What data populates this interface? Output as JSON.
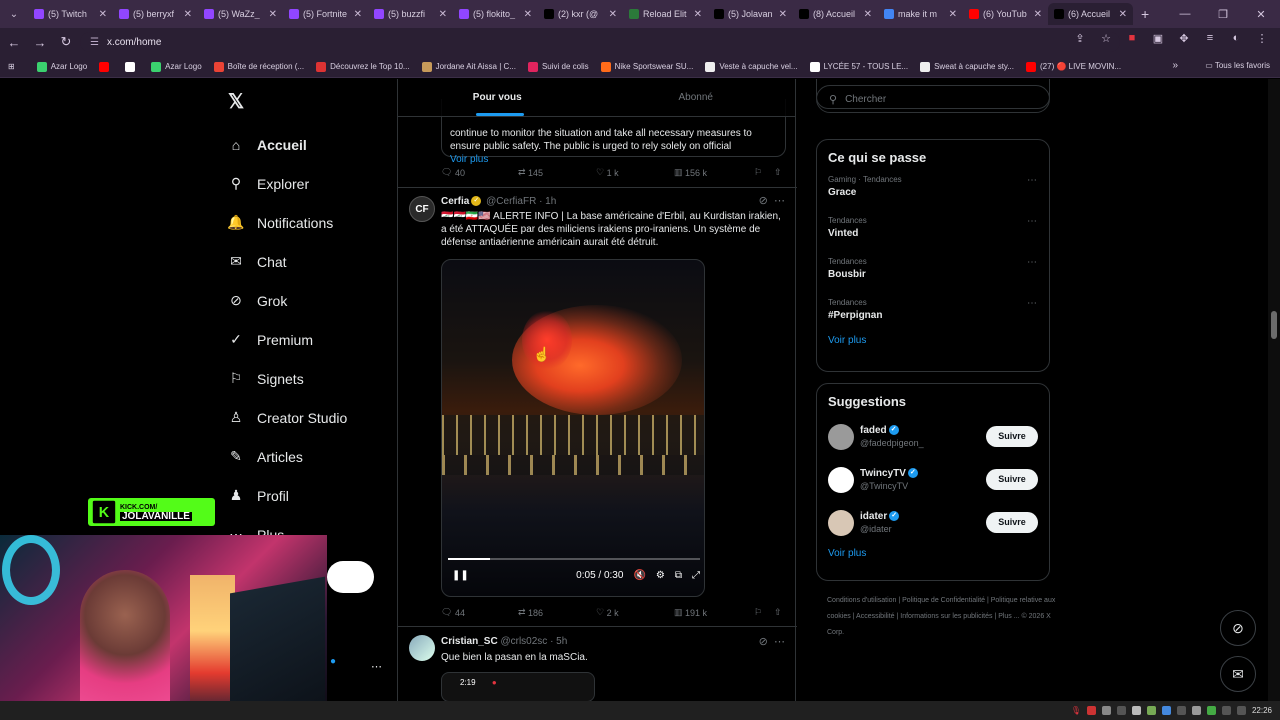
{
  "browser": {
    "tabs": [
      {
        "title": "(5) Twitch",
        "color": "#9146ff"
      },
      {
        "title": "(5) berryxf",
        "color": "#9146ff"
      },
      {
        "title": "(5) WaZz_",
        "color": "#9146ff"
      },
      {
        "title": "(5) Fortnite",
        "color": "#9146ff"
      },
      {
        "title": "(5) buzzfi",
        "color": "#9146ff"
      },
      {
        "title": "(5) flokito_",
        "color": "#9146ff"
      },
      {
        "title": "(2) kxr (@",
        "color": "#000000"
      },
      {
        "title": "Reload Elit",
        "color": "#2b7a3a"
      },
      {
        "title": "(5) Jolavan",
        "color": "#000000"
      },
      {
        "title": "(8) Accueil",
        "color": "#000000"
      },
      {
        "title": "make it m",
        "color": "#4285f4"
      },
      {
        "title": "(6) YouTub",
        "color": "#ff0000"
      },
      {
        "title": "(6) Accueil",
        "color": "#000000",
        "active": true
      }
    ],
    "url": "x.com/home",
    "bookmarks": [
      {
        "label": "Azar Logo",
        "color": "#3bd16f"
      },
      {
        "label": "",
        "color": "#ff0000"
      },
      {
        "label": "",
        "color": "#ffffff"
      },
      {
        "label": "Azar Logo",
        "color": "#3bd16f"
      },
      {
        "label": "Boîte de réception (...",
        "color": "#ea4335"
      },
      {
        "label": "Découvrez le Top 10...",
        "color": "#d33"
      },
      {
        "label": "Jordane Ait Aissa | C...",
        "color": "#c79a5a"
      },
      {
        "label": "Suivi de colis",
        "color": "#e0245e"
      },
      {
        "label": "Nike Sportswear SU...",
        "color": "#ff6b1a"
      },
      {
        "label": "Veste à capuche vel...",
        "color": "#eeeeee"
      },
      {
        "label": "LYCÉE 57 - TOUS LE...",
        "color": "#ffffff"
      },
      {
        "label": "Sweat à capuche sty...",
        "color": "#eeeeee"
      },
      {
        "label": "(27) 🔴 LIVE MOVIN...",
        "color": "#ff0000"
      }
    ],
    "all_bookmarks": "Tous les favoris"
  },
  "sidebar": {
    "items": [
      {
        "label": "Accueil",
        "icon": "home-icon",
        "glyph": "⌂",
        "active": true
      },
      {
        "label": "Explorer",
        "icon": "search-icon",
        "glyph": "⚲"
      },
      {
        "label": "Notifications",
        "icon": "bell-icon",
        "glyph": "🔔"
      },
      {
        "label": "Chat",
        "icon": "mail-icon",
        "glyph": "✉"
      },
      {
        "label": "Grok",
        "icon": "grok-icon",
        "glyph": "⊘"
      },
      {
        "label": "Premium",
        "icon": "verified-icon",
        "glyph": "✓"
      },
      {
        "label": "Signets",
        "icon": "bookmark-icon",
        "glyph": "⚐"
      },
      {
        "label": "Creator Studio",
        "icon": "creator-icon",
        "glyph": "♙"
      },
      {
        "label": "Articles",
        "icon": "article-icon",
        "glyph": "✎"
      },
      {
        "label": "Profil",
        "icon": "profile-icon",
        "glyph": "♟"
      },
      {
        "label": "Plus",
        "icon": "more-icon",
        "glyph": "⋯"
      }
    ]
  },
  "feed": {
    "tabs": [
      {
        "label": "Pour vous",
        "active": true
      },
      {
        "label": "Abonné"
      }
    ],
    "quoted_tail": {
      "text": "continue to monitor the situation and take all necessary measures to ensure public safety. The public is urged to rely solely on official",
      "more": "Voir plus",
      "stats": {
        "replies": "40",
        "reposts": "145",
        "likes": "1 k",
        "views": "156 k"
      }
    },
    "post1": {
      "name": "Cerfia",
      "handle": "@CerfiaFR · 1h",
      "text": "🇮🇶🇮🇶🇮🇷🇺🇸 ALERTE INFO | La base américaine d'Erbil, au Kurdistan irakien, a été ATTAQUÉE par des miliciens irakiens pro-iraniens. Un système de défense antiaérienne américain aurait été détruit.",
      "video_time": "0:05 / 0:30",
      "video_progress": 0.1667,
      "stats": {
        "replies": "44",
        "reposts": "186",
        "likes": "2 k",
        "views": "191 k"
      }
    },
    "post2": {
      "name": "Cristian_SC",
      "handle": "@crls02sc · 5h",
      "text": "Que bien la pasan en la maSCia.",
      "phone_time": "2:19"
    }
  },
  "right": {
    "search_placeholder": "Chercher",
    "trends_title": "Ce qui se passe",
    "trends": [
      {
        "category": "Gaming · Tendances",
        "name": "Grace"
      },
      {
        "category": "Tendances",
        "name": "Vinted"
      },
      {
        "category": "Tendances",
        "name": "Bousbir"
      },
      {
        "category": "Tendances",
        "name": "#Perpignan"
      }
    ],
    "trends_more": "Voir plus",
    "suggestions_title": "Suggestions",
    "suggestions": [
      {
        "name": "faded",
        "handle": "@fadedpigeon_",
        "button": "Suivre",
        "color": "#9a9a9a"
      },
      {
        "name": "TwincyTV",
        "handle": "@TwincyTV",
        "button": "Suivre",
        "color": "#ffffff"
      },
      {
        "name": "idater",
        "handle": "@idater",
        "button": "Suivre",
        "color": "#d8c7b5"
      }
    ],
    "suggestions_more": "Voir plus",
    "footer": "Conditions d'utilisation | Politique de Confidentialité | Politique relative aux cookies | Accessibilité | Informations sur les publicités | Plus ... © 2026 X Corp."
  },
  "overlay": {
    "kick_line1": "KICK.COM/",
    "kick_line2": "JOLAVANILLE"
  },
  "taskbar": {
    "time": "22:26"
  }
}
